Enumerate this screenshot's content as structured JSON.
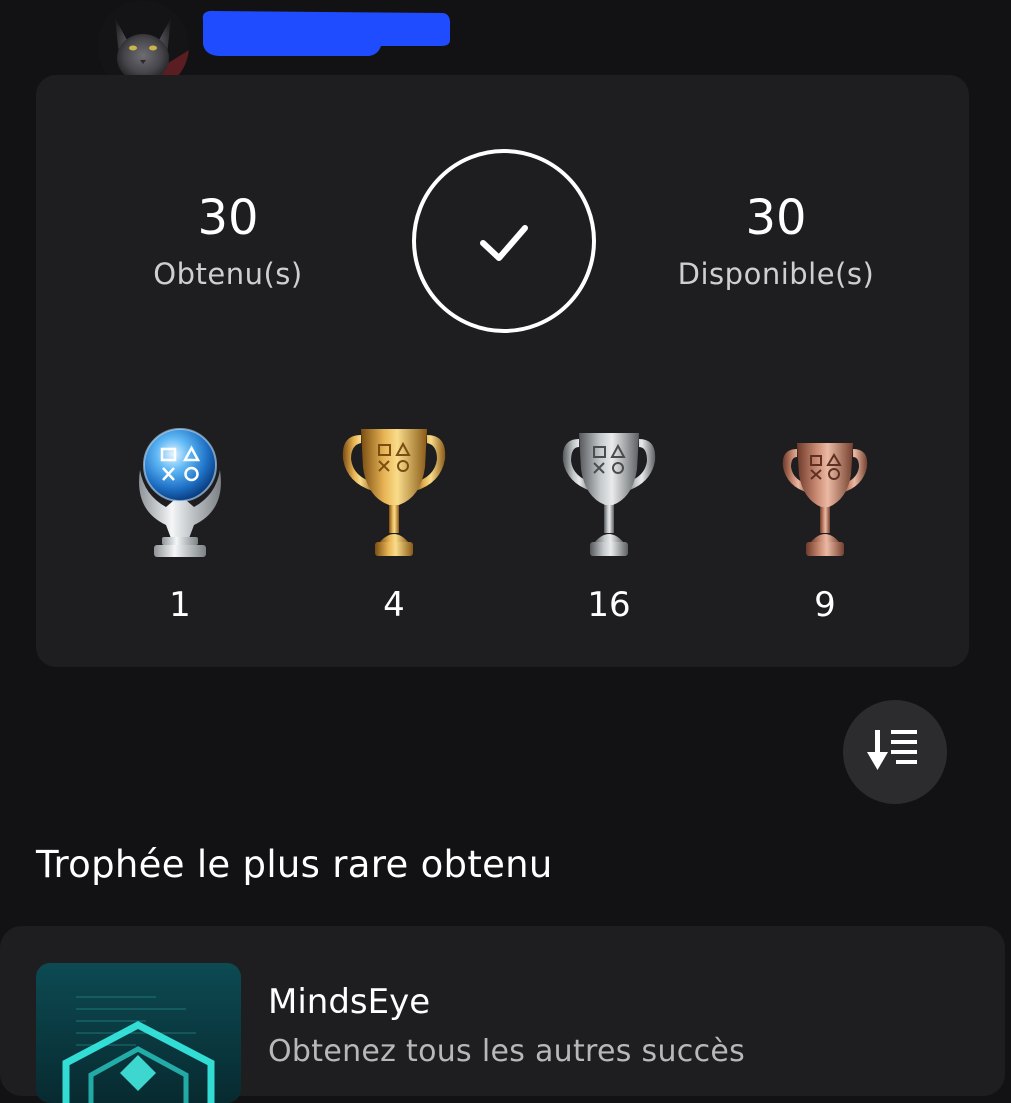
{
  "colors": {
    "background": "#121214",
    "card": "#1e1e21",
    "redaction": "#1f4cff",
    "text_secondary": "#cfcfd2"
  },
  "summary": {
    "earned": {
      "value": "30",
      "label": "Obtenu(s)"
    },
    "available": {
      "value": "30",
      "label": "Disponible(s)"
    },
    "status_icon": "checkmark-circle-icon"
  },
  "trophies": {
    "platinum": "1",
    "gold": "4",
    "silver": "16",
    "bronze": "9"
  },
  "sort": {
    "icon": "sort-descending-icon"
  },
  "rarest": {
    "section_title": "Trophée le plus rare obtenu",
    "game": "MindsEye",
    "description": "Obtenez tous les autres succès"
  }
}
